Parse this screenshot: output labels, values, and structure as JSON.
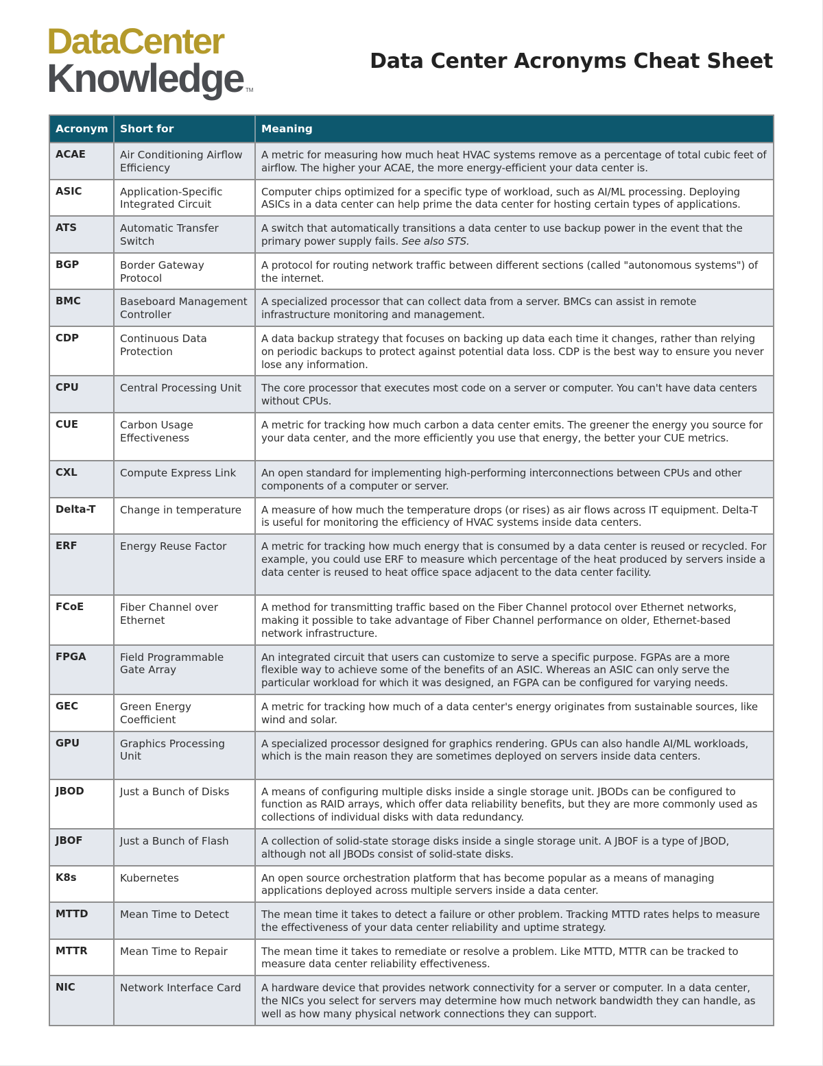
{
  "header": {
    "logo": {
      "line1": "DataCenter",
      "line2": "Knowledge",
      "trademark": "TM",
      "colors": {
        "line1": "#b49a2b",
        "line2": "#4a4c50"
      }
    },
    "title": "Data Center Acronyms Cheat Sheet"
  },
  "table": {
    "header_color": "#0d586e",
    "columns": [
      "Acronym",
      "Short for",
      "Meaning"
    ],
    "rows": [
      {
        "acronym": "ACAE",
        "short_for": "Air Conditioning Airflow Efficiency",
        "meaning": "A metric for measuring how much heat HVAC systems remove as a percentage of total cubic feet of airflow. The higher your ACAE, the more energy-efficient your data center is."
      },
      {
        "acronym": "ASIC",
        "short_for": "Application-Specific Integrated Circuit",
        "meaning": "Computer chips optimized for a specific type of workload, such as AI/ML processing. Deploying ASICs in a data center can help prime the data center for hosting certain types of applications."
      },
      {
        "acronym": "ATS",
        "short_for": "Automatic Transfer Switch",
        "meaning": "A switch that automatically transitions a data center to use backup power in the event that the primary power supply fails.",
        "meaning_italic": "See also STS."
      },
      {
        "acronym": "BGP",
        "short_for": "Border Gateway Protocol",
        "meaning": "A protocol for routing network traffic between different sections (called \"autonomous systems\") of the internet."
      },
      {
        "acronym": "BMC",
        "short_for": "Baseboard Management Controller",
        "meaning": "A specialized processor that can collect data from a server. BMCs can assist in remote infrastructure monitoring and management."
      },
      {
        "acronym": "CDP",
        "short_for": "Continuous Data Protection",
        "meaning": "A data backup strategy that focuses on backing up data each time it changes, rather than relying on periodic backups to protect against potential data loss. CDP is the best way to ensure you never lose any information."
      },
      {
        "acronym": "CPU",
        "short_for": "Central Processing Unit",
        "meaning": "The core processor that executes most code on a server or computer. You can't have data centers without CPUs."
      },
      {
        "acronym": "CUE",
        "short_for": "Carbon Usage Effectiveness",
        "meaning": "A metric for tracking how much carbon a data center emits. The greener the energy you source for your data center, and the more efficiently you use that energy, the better your CUE metrics."
      },
      {
        "acronym": "CXL",
        "short_for": "Compute Express Link",
        "meaning": "An open standard for implementing high-performing interconnections between CPUs and other components of a computer or server."
      },
      {
        "acronym": "Delta-T",
        "short_for": "Change in temperature",
        "meaning": "A measure of how much the temperature drops (or rises) as air flows across IT equipment. Delta-T is useful for monitoring the efficiency of HVAC systems inside data centers."
      },
      {
        "acronym": "ERF",
        "short_for": "Energy Reuse Factor",
        "meaning": "A metric for tracking how much energy that is consumed by a data center is reused or recycled. For example, you could use ERF to measure which percentage of the heat produced by servers inside a data center is reused to heat office space adjacent to the data center facility."
      },
      {
        "acronym": "FCoE",
        "short_for": "Fiber Channel over Ethernet",
        "meaning": "A method for transmitting traffic based on the Fiber Channel protocol over Ethernet networks, making it possible to take advantage of Fiber Channel performance on older, Ethernet-based network infrastructure."
      },
      {
        "acronym": "FPGA",
        "short_for": "Field Programmable Gate Array",
        "meaning": "An integrated circuit that users can customize to serve a specific purpose. FGPAs are a more flexible way to achieve some of the benefits of an ASIC. Whereas an ASIC can only serve the particular workload for which it was designed, an FGPA can be configured for varying needs."
      },
      {
        "acronym": "GEC",
        "short_for": "Green Energy Coefficient",
        "meaning": "A metric for tracking how much of a data center's energy originates from sustainable sources, like wind and solar."
      },
      {
        "acronym": "GPU",
        "short_for": "Graphics Processing Unit",
        "meaning": "A specialized processor designed for graphics rendering. GPUs can also handle AI/ML workloads, which is the main reason they are sometimes deployed on servers inside data centers."
      },
      {
        "acronym": "JBOD",
        "short_for": "Just a Bunch of Disks",
        "meaning": "A means of configuring multiple disks inside a single storage unit. JBODs can be configured to function as RAID arrays, which offer data reliability benefits, but they are more commonly used as collections of individual disks with data redundancy."
      },
      {
        "acronym": "JBOF",
        "short_for": "Just a Bunch of Flash",
        "meaning": "A collection of solid-state storage disks inside a single storage unit. A JBOF is a type of JBOD, although not all JBODs consist of solid-state disks."
      },
      {
        "acronym": "K8s",
        "short_for": "Kubernetes",
        "meaning": "An open source orchestration platform that has become popular as a means of managing applications deployed across multiple servers inside a data center."
      },
      {
        "acronym": "MTTD",
        "short_for": "Mean Time to Detect",
        "meaning": "The mean time it takes to detect a failure or other problem. Tracking MTTD rates helps to measure the effectiveness of your data center reliability and uptime strategy."
      },
      {
        "acronym": "MTTR",
        "short_for": "Mean Time to Repair",
        "meaning": "The mean time it takes to remediate or resolve a problem. Like MTTD, MTTR can be tracked to measure data center reliability effectiveness."
      },
      {
        "acronym": "NIC",
        "short_for": "Network Interface Card",
        "meaning": "A hardware device that provides network connectivity for a server or computer. In a data center, the NICs you select for servers may determine how much network bandwidth they can handle, as well as how many physical network connections they can support."
      }
    ]
  }
}
